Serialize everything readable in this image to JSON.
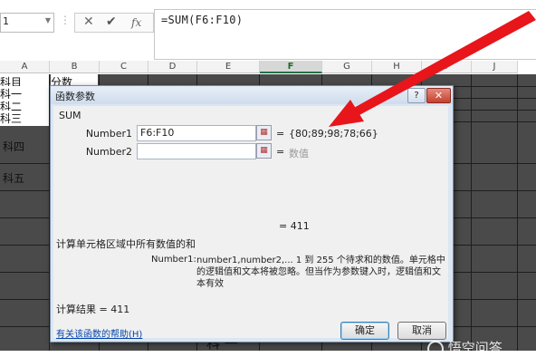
{
  "formula_bar": {
    "name_box": "1",
    "cancel_icon": "✕",
    "enter_icon": "✔",
    "fx_label": "fx",
    "formula": "=SUM(F6:F10)"
  },
  "sheet": {
    "columns": [
      "A",
      "B",
      "C",
      "D",
      "E",
      "F",
      "G",
      "H",
      "I",
      "J"
    ],
    "selected_column": "F",
    "cells": {
      "b_header": "分数",
      "a_header": "科目",
      "row_labels": [
        "科一",
        "科二",
        "科三",
        "科四",
        "科五"
      ]
    },
    "bottom_text": "科 一"
  },
  "dialog": {
    "title": "函数参数",
    "help_button": "?",
    "close_button": "✕",
    "function_name": "SUM",
    "args": [
      {
        "label": "Number1",
        "value": "F6:F10",
        "result": "{80;89;98;78;66}"
      },
      {
        "label": "Number2",
        "value": "",
        "result": "数值"
      }
    ],
    "equals": "=",
    "total": "= 411",
    "description": "计算单元格区域中所有数值的和",
    "param_name": "Number1:",
    "param_desc": "number1,number2,... 1 到 255 个待求和的数值。单元格中的逻辑值和文本将被忽略。但当作为参数键入时，逻辑值和文本有效",
    "calc_result": "计算结果 =  411",
    "help_link": "有关该函数的帮助(H)",
    "ok_label": "确定",
    "cancel_label": "取消"
  },
  "watermark": "悟空问答",
  "colors": {
    "arrow": "#e8151b",
    "dialog_bg": "#f0f0f0",
    "title_bg": "#dbe6f3",
    "close_red": "#c6402f"
  }
}
